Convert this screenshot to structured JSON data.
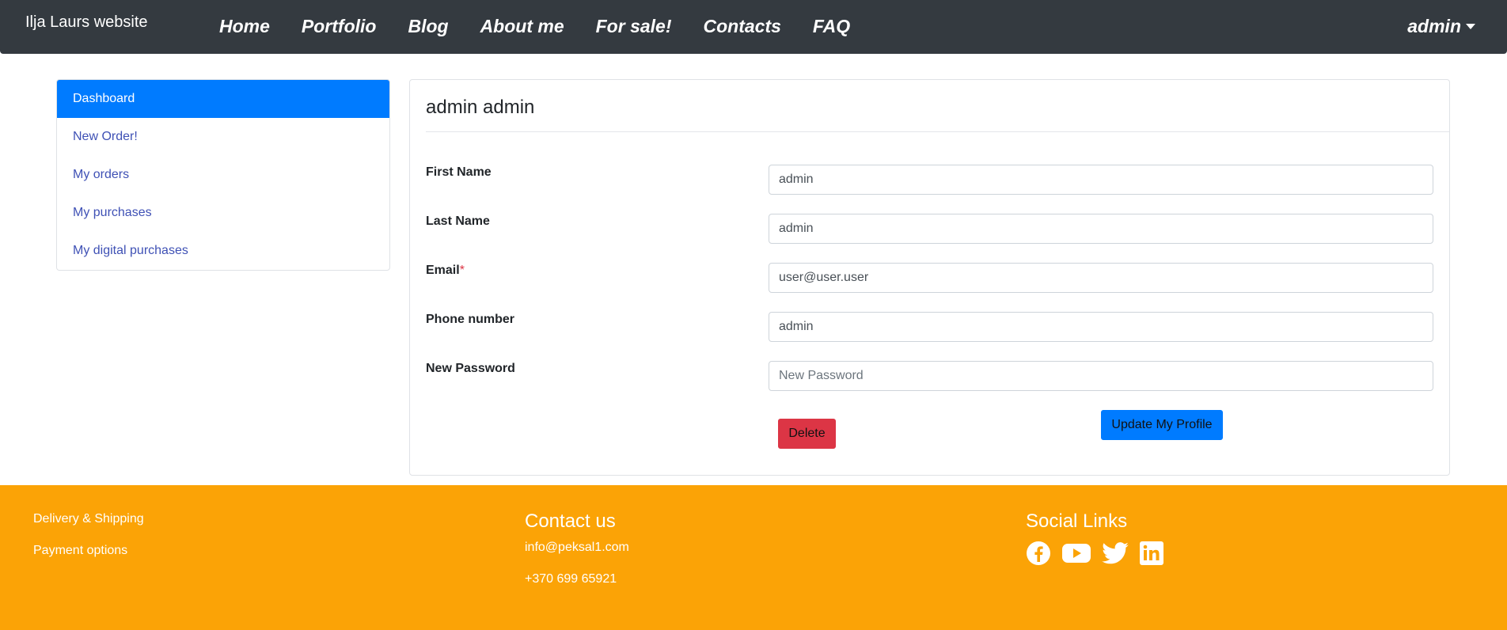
{
  "navbar": {
    "brand": "Ilja Laurs website",
    "links": [
      {
        "label": "Home"
      },
      {
        "label": "Portfolio"
      },
      {
        "label": "Blog"
      },
      {
        "label": "About me"
      },
      {
        "label": "For sale!"
      },
      {
        "label": "Contacts"
      },
      {
        "label": "FAQ"
      }
    ],
    "user_menu": "admin"
  },
  "sidebar": {
    "items": [
      {
        "label": "Dashboard",
        "active": true
      },
      {
        "label": "New Order!",
        "active": false
      },
      {
        "label": "My orders",
        "active": false
      },
      {
        "label": "My purchases",
        "active": false
      },
      {
        "label": "My digital purchases",
        "active": false
      }
    ]
  },
  "profile": {
    "title": "admin admin",
    "fields": [
      {
        "label": "First Name",
        "value": "admin",
        "placeholder": ""
      },
      {
        "label": "Last Name",
        "value": "admin",
        "placeholder": ""
      },
      {
        "label": "Email",
        "required_mark": "*",
        "value": "user@user.user",
        "placeholder": ""
      },
      {
        "label": "Phone number",
        "value": "admin",
        "placeholder": ""
      },
      {
        "label": "New Password",
        "value": "",
        "placeholder": "New Password"
      }
    ],
    "delete_label": "Delete",
    "update_label": "Update My Profile"
  },
  "footer": {
    "links": [
      "Delivery & Shipping",
      "Payment options"
    ],
    "contact_heading": "Contact us",
    "email": "info@peksal1.com",
    "phone": "+370 699 65921",
    "social_heading": "Social Links",
    "social_icons": [
      "facebook-icon",
      "youtube-icon",
      "twitter-icon",
      "linkedin-icon"
    ]
  },
  "colors": {
    "navbar_bg": "#343a40",
    "primary": "#007bff",
    "danger": "#dc3545",
    "footer_bg": "#fba306",
    "sidebar_link": "#3f51b5"
  }
}
